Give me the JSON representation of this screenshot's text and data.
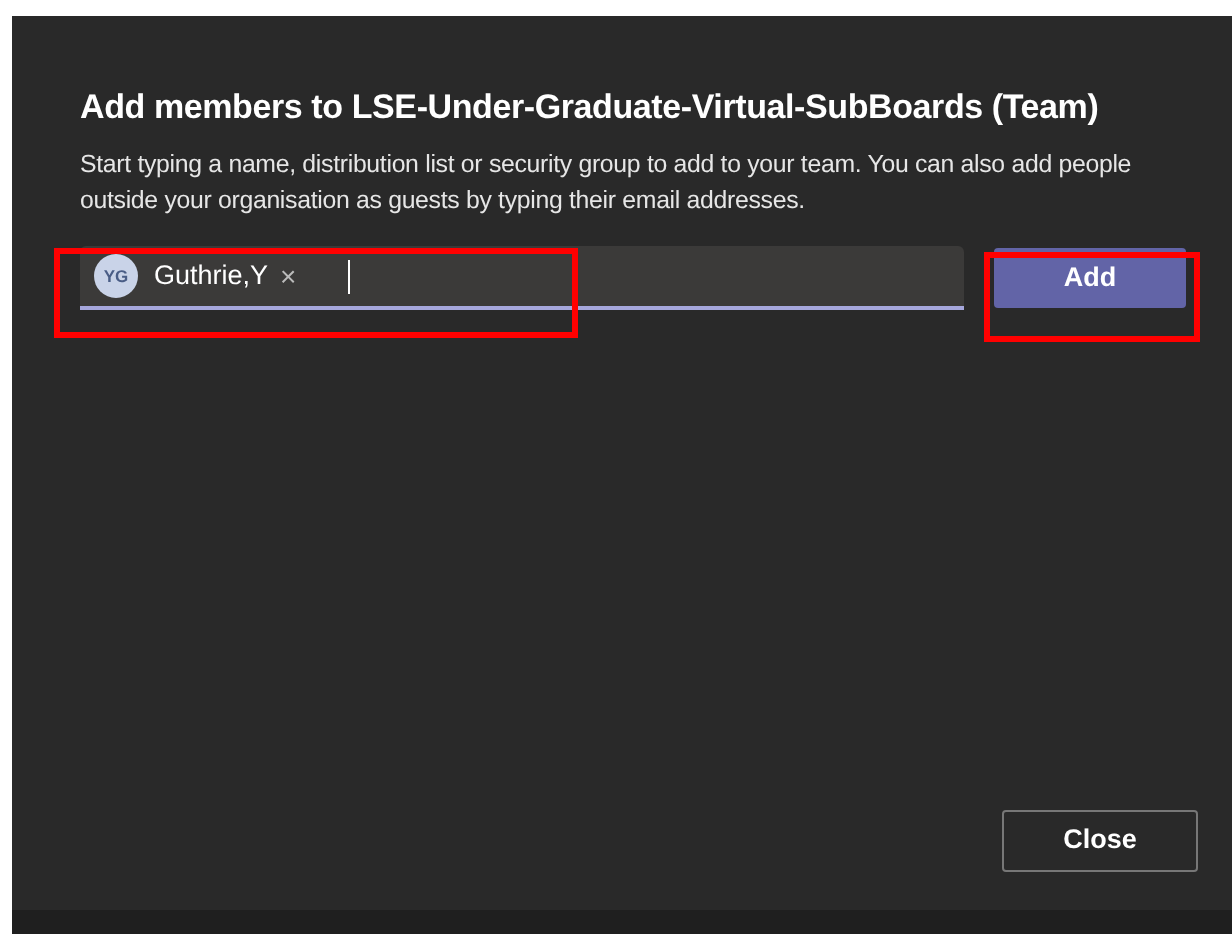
{
  "dialog": {
    "title": "Add members to LSE-Under-Graduate-Virtual-SubBoards (Team)",
    "description": "Start typing a name, distribution list or security group to add to your team. You can also add people outside your organisation as guests by typing their email addresses."
  },
  "people_picker": {
    "highlighted": true,
    "chips": [
      {
        "initials": "YG",
        "name": "Guthrie,Y",
        "remove": "×"
      }
    ]
  },
  "add_button": {
    "label": "Add",
    "highlighted": true
  },
  "close_button": {
    "label": "Close"
  }
}
